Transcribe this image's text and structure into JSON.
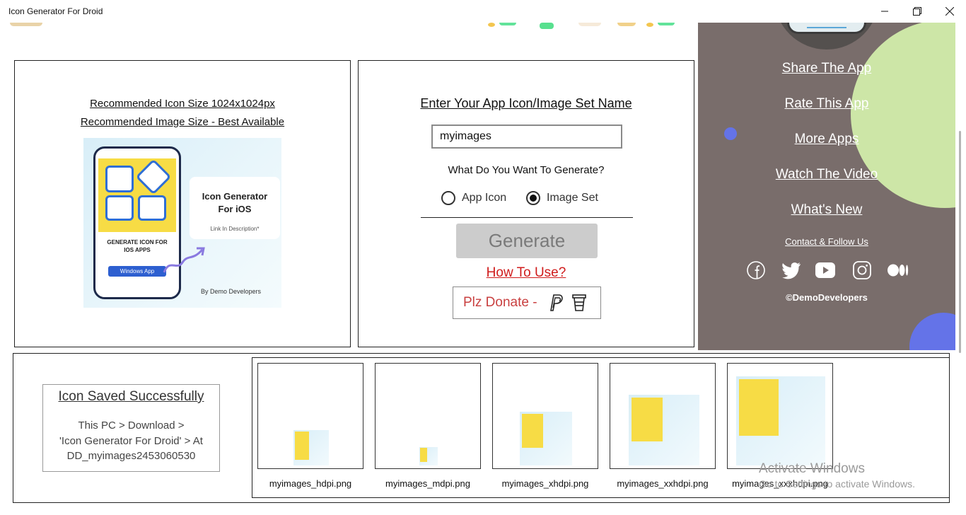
{
  "window": {
    "title": "Icon Generator For Droid",
    "controls": [
      "minimize-icon",
      "restore-icon",
      "close-icon"
    ]
  },
  "preview_panel": {
    "recommended_icon_size": "Recommended Icon Size 1024x1024px",
    "recommended_image_size": "Recommended Image Size - Best Available",
    "preview_image": {
      "title_line1": "Icon Generator",
      "title_line2": "For iOS",
      "subtitle": "Link In Description*",
      "phone_caption_line1": "GENERATE ICON FOR",
      "phone_caption_line2": "IOS APPS",
      "phone_button": "Windows App",
      "credit": "By Demo Developers"
    }
  },
  "generator_panel": {
    "name_label": "Enter Your App Icon/Image Set Name",
    "name_value": "myimages",
    "question": "What Do You Want To Generate?",
    "options": [
      {
        "label": "App Icon",
        "selected": false
      },
      {
        "label": "Image Set",
        "selected": true
      }
    ],
    "generate_label": "Generate",
    "generate_enabled": false,
    "how_to_label": "How To Use?",
    "donate_label": "Plz Donate -",
    "donate_icons": [
      "paypal-icon",
      "coffee-cup-icon"
    ]
  },
  "side_panel": {
    "links": [
      "Share The App",
      "Rate This App",
      "More Apps",
      "Watch The Video",
      "What's New"
    ],
    "contact_label": "Contact & Follow Us",
    "social_icons": [
      "facebook-icon",
      "twitter-icon",
      "youtube-icon",
      "instagram-icon",
      "medium-icon"
    ],
    "copyright": "©DemoDevelopers",
    "colors": {
      "background": "#796d6b",
      "circle_green": "#cde6a7",
      "circle_blue": "#6473e8"
    }
  },
  "result": {
    "saved_title": "Icon Saved Successfully",
    "saved_lines": [
      "This PC > Download >",
      "'Icon Generator For Droid' > At",
      "DD_myimages2453060530"
    ]
  },
  "thumbnails": [
    {
      "label": "myimages_hdpi.png"
    },
    {
      "label": "myimages_mdpi.png"
    },
    {
      "label": "myimages_xhdpi.png"
    },
    {
      "label": "myimages_xxhdpi.png"
    },
    {
      "label": "myimages_xxxhdpi.png"
    }
  ],
  "watermark": {
    "line1": "Activate Windows",
    "line2": "Go to Settings to activate Windows."
  }
}
